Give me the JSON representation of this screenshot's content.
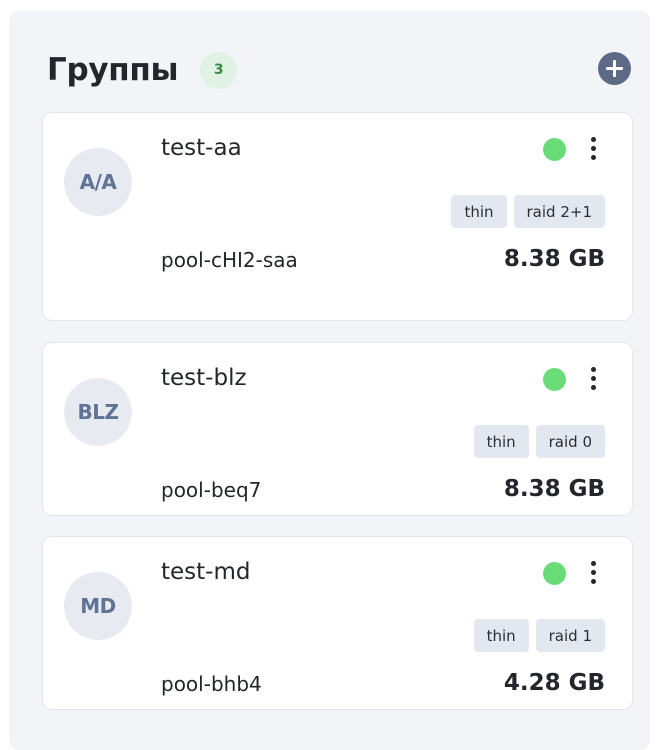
{
  "header": {
    "title": "Группы",
    "count": "3"
  },
  "colors": {
    "status_online": "#69dc7a",
    "accent": "#5d6a86",
    "count_badge_bg": "#dff2e4"
  },
  "groups": [
    {
      "initials": "A/A",
      "name": "test-aa",
      "status": "online",
      "tags": [
        "thin",
        "raid 2+1"
      ],
      "pool": "pool-cHI2-saa",
      "size": "8.38 GB"
    },
    {
      "initials": "BLZ",
      "name": "test-blz",
      "status": "online",
      "tags": [
        "thin",
        "raid 0"
      ],
      "pool": "pool-beq7",
      "size": "8.38 GB"
    },
    {
      "initials": "MD",
      "name": "test-md",
      "status": "online",
      "tags": [
        "thin",
        "raid 1"
      ],
      "pool": "pool-bhb4",
      "size": "4.28 GB"
    }
  ]
}
